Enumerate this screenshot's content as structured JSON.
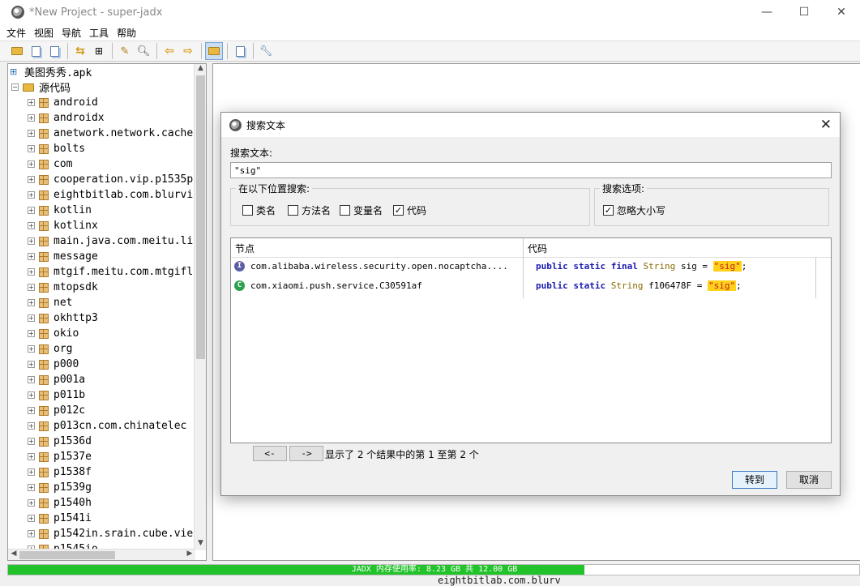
{
  "window": {
    "title": "*New Project - super-jadx",
    "min": "—",
    "max": "☐",
    "close": "✕"
  },
  "menu": [
    "文件",
    "视图",
    "导航",
    "工具",
    "帮助"
  ],
  "tree": {
    "root": "美图秀秀.apk",
    "source_node": "源代码",
    "packages": [
      "android",
      "androidx",
      "anetwork.network.cache",
      "bolts",
      "com",
      "cooperation.vip.p1535p",
      "eightbitlab.com.blurvi",
      "kotlin",
      "kotlinx",
      "main.java.com.meitu.li",
      "message",
      "mtgif.meitu.com.mtgifl",
      "mtopsdk",
      "net",
      "okhttp3",
      "okio",
      "org",
      "p000",
      "p001a",
      "p011b",
      "p012c",
      "p013cn.com.chinatelec",
      "p1536d",
      "p1537e",
      "p1538f",
      "p1539g",
      "p1540h",
      "p1541i",
      "p1542in.srain.cube.vie",
      "p1545io"
    ]
  },
  "status": {
    "memory": "JADX 内存使用率: 8.23 GB 共 12.00 GB",
    "memory_fraction": 0.677
  },
  "below_text": "eightbitlab.com.blurv",
  "dialog": {
    "title": "搜索文本",
    "search_label": "搜索文本:",
    "search_value": "\"sig\"",
    "location_group": "在以下位置搜索:",
    "locations": [
      {
        "label": "类名",
        "checked": false
      },
      {
        "label": "方法名",
        "checked": false
      },
      {
        "label": "变量名",
        "checked": false
      },
      {
        "label": "代码",
        "checked": true
      }
    ],
    "options_group": "搜索选项:",
    "options": [
      {
        "label": "忽略大小写",
        "checked": true
      }
    ],
    "columns": {
      "node": "节点",
      "code": "代码"
    },
    "results": [
      {
        "icon": "I",
        "node": "com.alibaba.wireless.security.open.nocaptcha....",
        "kw": "public static final",
        "type": "String",
        "name": "sig =",
        "value": "\"sig\"",
        "end": ";"
      },
      {
        "icon": "C",
        "node": "com.xiaomi.push.service.C30591af",
        "kw": "public static",
        "type": "String",
        "name": "f106478F =",
        "value": "\"sig\"",
        "end": ";"
      }
    ],
    "prev": "<-",
    "next": "->",
    "pager_text": "显示了 2 个结果中的第 1 至第 2 个",
    "goto": "转到",
    "cancel": "取消"
  }
}
